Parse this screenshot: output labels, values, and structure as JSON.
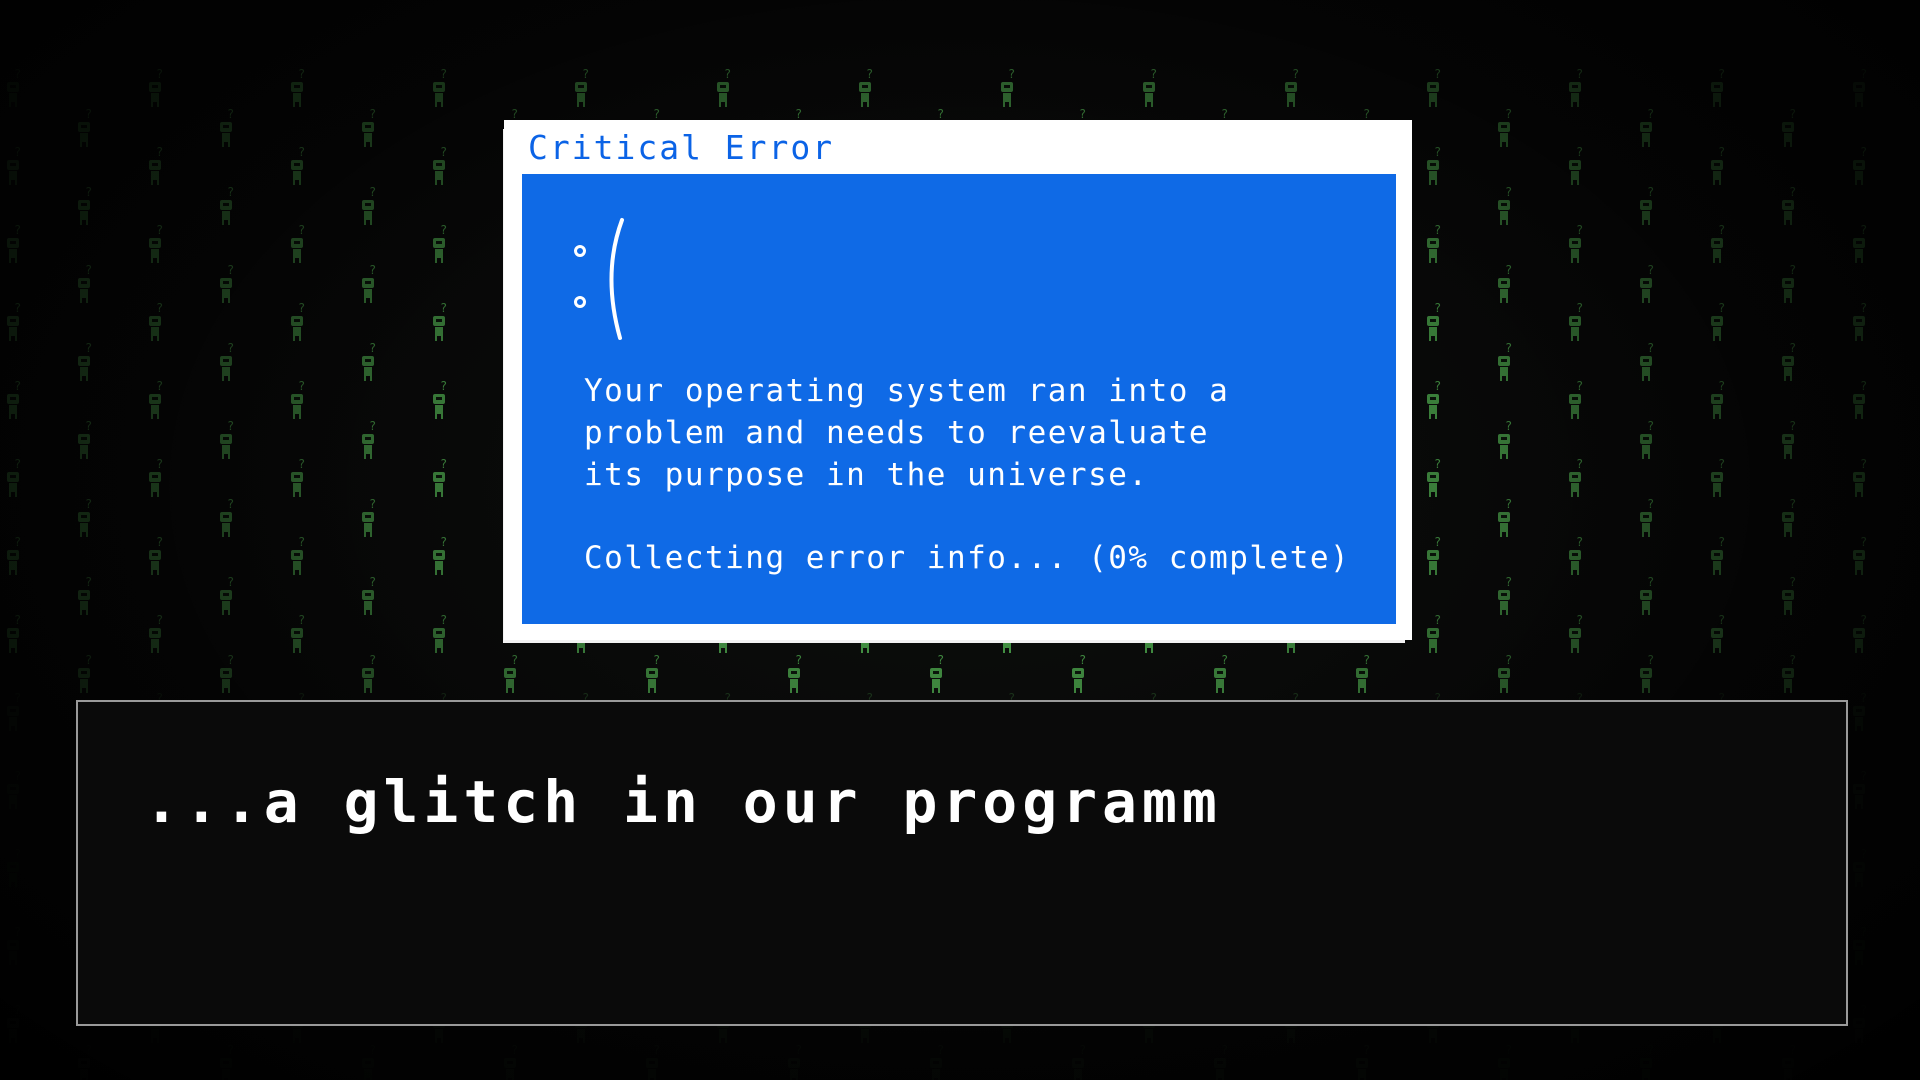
{
  "error_window": {
    "title": "Critical Error",
    "face": ":(",
    "message": "Your operating system ran into a\nproblem and needs to reevaluate\nits purpose in the universe.",
    "progress": "Collecting error info... (0% complete)",
    "progress_percent": 0
  },
  "dialogue": {
    "text": "...a glitch in our programm"
  },
  "colors": {
    "error_blue": "#0f6ae6",
    "title_blue": "#0b63e6",
    "matrix_green": "#5fd35f",
    "background": "#050505",
    "dialogue_border": "#9a9a9a"
  },
  "background_pattern": {
    "icon": "robot-question-icon",
    "glyph": "?"
  }
}
